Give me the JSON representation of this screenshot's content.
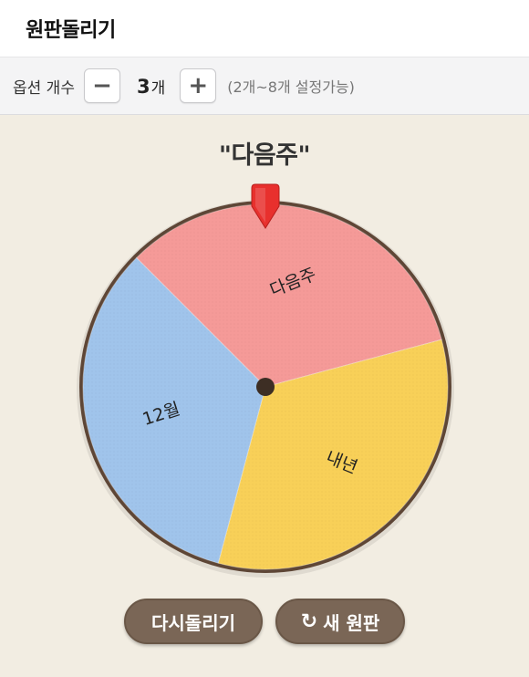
{
  "header": {
    "title": "원판돌리기"
  },
  "options": {
    "label": "옵션 개수",
    "minus_glyph": "−",
    "plus_glyph": "+",
    "count": "3",
    "count_unit": "개",
    "range_hint": "(2개~8개 설정가능)"
  },
  "result": {
    "text": "\"다음주\""
  },
  "wheel": {
    "slices": [
      {
        "label": "다음주",
        "color": "#f59a98",
        "share": 0.3333
      },
      {
        "label": "내년",
        "color": "#f8d058",
        "share": 0.3333
      },
      {
        "label": "12월",
        "color": "#a0c4eb",
        "share": 0.3333
      }
    ],
    "rim_color": "#5e4636",
    "pointer_color": "#e8302d"
  },
  "buttons": {
    "respin_label": "다시돌리기",
    "new_label": "새 원판",
    "new_icon": "refresh-icon"
  }
}
